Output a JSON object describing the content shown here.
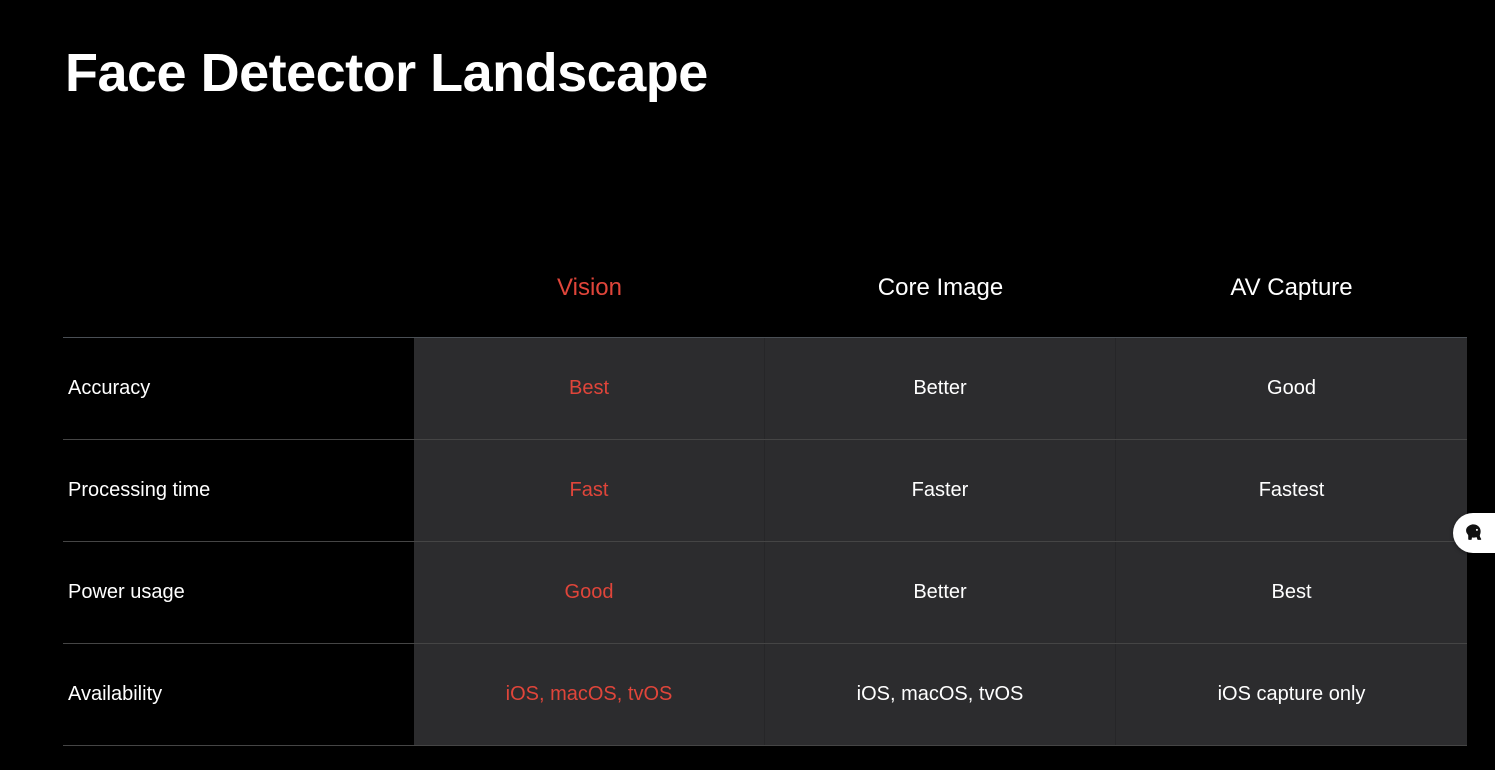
{
  "slide": {
    "title": "Face Detector Landscape"
  },
  "table": {
    "columns": [
      "Vision",
      "Core Image",
      "AV Capture"
    ],
    "rows": [
      {
        "label": "Accuracy",
        "values": [
          "Best",
          "Better",
          "Good"
        ]
      },
      {
        "label": "Processing time",
        "values": [
          "Fast",
          "Faster",
          "Fastest"
        ]
      },
      {
        "label": "Power usage",
        "values": [
          "Good",
          "Better",
          "Best"
        ]
      },
      {
        "label": "Availability",
        "values": [
          "iOS, macOS, tvOS",
          "iOS, macOS, tvOS",
          "iOS capture only"
        ]
      }
    ]
  },
  "colors": {
    "background": "#000000",
    "cell_background": "#2c2c2e",
    "accent": "#e0453a",
    "text": "#ffffff"
  },
  "overlay": {
    "icon": "evernote-elephant-icon"
  }
}
